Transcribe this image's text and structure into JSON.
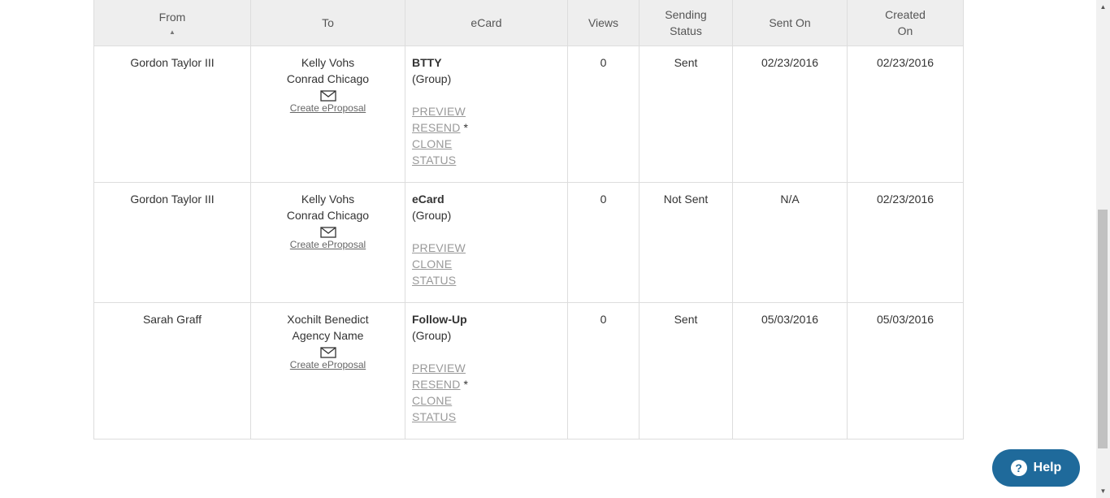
{
  "table": {
    "headers": {
      "from": "From",
      "to": "To",
      "ecard": "eCard",
      "views": "Views",
      "sending_status": "Sending Status",
      "sent_on": "Sent On",
      "created_on": "Created On"
    },
    "sort_indicator": "▲",
    "rows": [
      {
        "from": "Gordon Taylor III",
        "to_name": "Kelly Vohs",
        "to_company": "Conrad Chicago",
        "create_eproposal": "Create eProposal",
        "ecard_name": "BTTY",
        "ecard_type": "(Group)",
        "actions": [
          "PREVIEW",
          "RESEND",
          "CLONE",
          "STATUS"
        ],
        "views": "0",
        "sending_status": "Sent",
        "sent_on": "02/23/2016",
        "created_on": "02/23/2016"
      },
      {
        "from": "Gordon Taylor III",
        "to_name": "Kelly Vohs",
        "to_company": "Conrad Chicago",
        "create_eproposal": "Create eProposal",
        "ecard_name": "eCard",
        "ecard_type": "(Group)",
        "actions": [
          "PREVIEW",
          "CLONE",
          "STATUS"
        ],
        "views": "0",
        "sending_status": "Not Sent",
        "sent_on": "N/A",
        "created_on": "02/23/2016"
      },
      {
        "from": "Sarah Graff",
        "to_name": "Xochilt Benedict",
        "to_company": "Agency Name",
        "create_eproposal": "Create eProposal",
        "ecard_name": "Follow-Up",
        "ecard_type": "(Group)",
        "actions": [
          "PREVIEW",
          "RESEND",
          "CLONE",
          "STATUS"
        ],
        "views": "0",
        "sending_status": "Sent",
        "sent_on": "05/03/2016",
        "created_on": "05/03/2016"
      }
    ],
    "resend_marker": "*"
  },
  "help_button": {
    "label": "Help",
    "icon": "question-circle-icon",
    "icon_glyph": "?"
  },
  "colors": {
    "help_bg": "#1f6a9b",
    "header_bg": "#eeeeee",
    "link_gray": "#999999"
  }
}
